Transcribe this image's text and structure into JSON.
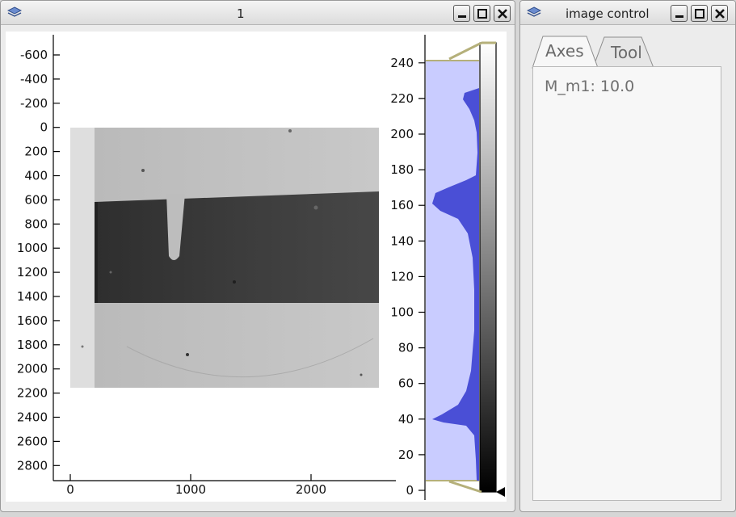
{
  "main_window": {
    "title": "1",
    "icon": "stacked-layers-icon",
    "buttons": [
      "minimize",
      "maximize",
      "close"
    ]
  },
  "image_plot": {
    "y_ticks": [
      "-600",
      "-400",
      "-200",
      "0",
      "200",
      "400",
      "600",
      "800",
      "1000",
      "1200",
      "1400",
      "1600",
      "1800",
      "2000",
      "2200",
      "2400",
      "2600",
      "2800"
    ],
    "x_ticks": [
      "0",
      "1000",
      "2000"
    ],
    "colormap": "grayscale"
  },
  "histogram": {
    "y_ticks": [
      "0",
      "20",
      "40",
      "60",
      "80",
      "100",
      "120",
      "140",
      "160",
      "180",
      "200",
      "220",
      "240"
    ],
    "fill_color": "#4a4fd6",
    "range_color": "#c9ccff",
    "handle_color": "#b5b07a"
  },
  "control_window": {
    "title": "image control",
    "icon": "stacked-layers-icon",
    "tabs": [
      {
        "label": "Axes",
        "active": true
      },
      {
        "label": "Tool",
        "active": false
      }
    ],
    "readout": "M_m1: 10.0"
  }
}
